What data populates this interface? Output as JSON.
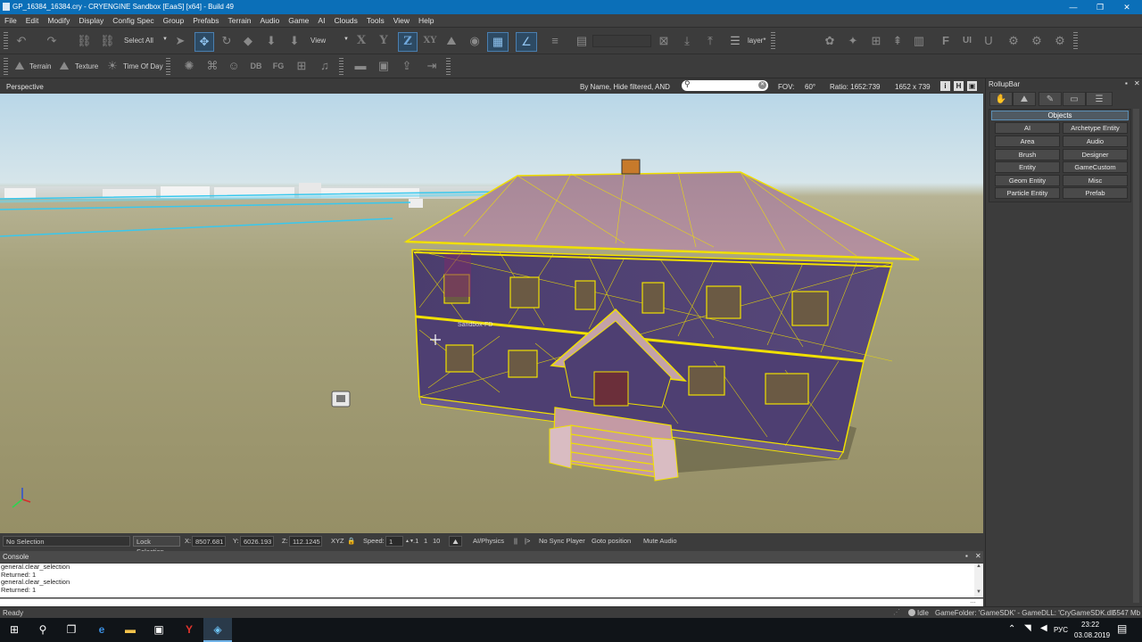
{
  "window": {
    "title": "GP_16384_16384.cry - CRYENGINE Sandbox [EaaS] [x64] - Build 49",
    "minimize": "—",
    "maximize": "❐",
    "close": "✕"
  },
  "menu": [
    "File",
    "Edit",
    "Modify",
    "Display",
    "Config Spec",
    "Group",
    "Prefabs",
    "Terrain",
    "Audio",
    "Game",
    "AI",
    "Clouds",
    "Tools",
    "View",
    "Help"
  ],
  "toolbar": {
    "select_all": "Select All",
    "coord_space": "View",
    "axes": [
      "X",
      "Y",
      "Z",
      "XY"
    ],
    "active_axis": "Z",
    "layer": "layer*",
    "terrain": "Terrain",
    "texture": "Texture",
    "time_of_day": "Time Of Day",
    "labels_misc": [
      "DB",
      "FG"
    ]
  },
  "viewport_header": {
    "name": "Perspective",
    "filter": "By Name, Hide filtered, AND",
    "search_placeholder": "",
    "fov_label": "FOV:",
    "fov_value": "60°",
    "ratio_label": "Ratio: 1652:739",
    "resolution": "1652 x 739",
    "btns": [
      "i",
      "H"
    ]
  },
  "viewport": {
    "object_label": "Sandbox-FD"
  },
  "status_strip": {
    "selection": "No Selection",
    "lock_selection": "Lock Selection",
    "x_label": "X:",
    "x_value": "8507.681",
    "y_label": "Y:",
    "y_value": "6026.193",
    "z_label": "Z:",
    "z_value": "112.1245",
    "xyz": "XYZ",
    "speed_label": "Speed:",
    "speed_value": "1",
    "speed_presets": [
      ".1",
      "1",
      "10"
    ],
    "ai_physics": "AI/Physics",
    "pause": "||",
    "play": "|>",
    "no_sync_player": "No Sync Player",
    "goto_position": "Goto position",
    "mute_audio": "Mute Audio"
  },
  "console": {
    "title": "Console",
    "lines": [
      "general.clear_selection",
      "Returned: 1",
      "general.clear_selection",
      "Returned: 1"
    ]
  },
  "rollup": {
    "title": "RollupBar",
    "panel_title": "Objects",
    "buttons": [
      [
        "AI",
        "Archetype Entity"
      ],
      [
        "Area",
        "Audio"
      ],
      [
        "Brush",
        "Designer"
      ],
      [
        "Entity",
        "GameCustom"
      ],
      [
        "Geom Entity",
        "Misc"
      ],
      [
        "Particle Entity",
        "Prefab"
      ]
    ]
  },
  "statusbar": {
    "left": "Ready",
    "idle": "Idle",
    "game_info": "GameFolder: 'GameSDK' - GameDLL: 'CryGameSDK.dll'",
    "memory": "5547 Mb"
  },
  "taskbar": {
    "language": "РУС",
    "time": "23:22",
    "date": "03.08.2019"
  },
  "colors": {
    "accent": "#0b6fb8",
    "wire": "#f0e000"
  }
}
